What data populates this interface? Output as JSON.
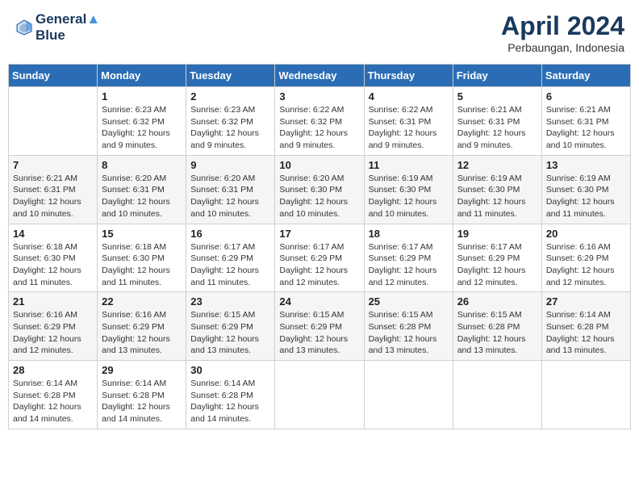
{
  "header": {
    "logo_line1": "General",
    "logo_line2": "Blue",
    "month_year": "April 2024",
    "location": "Perbaungan, Indonesia"
  },
  "weekdays": [
    "Sunday",
    "Monday",
    "Tuesday",
    "Wednesday",
    "Thursday",
    "Friday",
    "Saturday"
  ],
  "weeks": [
    [
      {
        "day": "",
        "info": ""
      },
      {
        "day": "1",
        "info": "Sunrise: 6:23 AM\nSunset: 6:32 PM\nDaylight: 12 hours\nand 9 minutes."
      },
      {
        "day": "2",
        "info": "Sunrise: 6:23 AM\nSunset: 6:32 PM\nDaylight: 12 hours\nand 9 minutes."
      },
      {
        "day": "3",
        "info": "Sunrise: 6:22 AM\nSunset: 6:32 PM\nDaylight: 12 hours\nand 9 minutes."
      },
      {
        "day": "4",
        "info": "Sunrise: 6:22 AM\nSunset: 6:31 PM\nDaylight: 12 hours\nand 9 minutes."
      },
      {
        "day": "5",
        "info": "Sunrise: 6:21 AM\nSunset: 6:31 PM\nDaylight: 12 hours\nand 9 minutes."
      },
      {
        "day": "6",
        "info": "Sunrise: 6:21 AM\nSunset: 6:31 PM\nDaylight: 12 hours\nand 10 minutes."
      }
    ],
    [
      {
        "day": "7",
        "info": "Sunrise: 6:21 AM\nSunset: 6:31 PM\nDaylight: 12 hours\nand 10 minutes."
      },
      {
        "day": "8",
        "info": "Sunrise: 6:20 AM\nSunset: 6:31 PM\nDaylight: 12 hours\nand 10 minutes."
      },
      {
        "day": "9",
        "info": "Sunrise: 6:20 AM\nSunset: 6:31 PM\nDaylight: 12 hours\nand 10 minutes."
      },
      {
        "day": "10",
        "info": "Sunrise: 6:20 AM\nSunset: 6:30 PM\nDaylight: 12 hours\nand 10 minutes."
      },
      {
        "day": "11",
        "info": "Sunrise: 6:19 AM\nSunset: 6:30 PM\nDaylight: 12 hours\nand 10 minutes."
      },
      {
        "day": "12",
        "info": "Sunrise: 6:19 AM\nSunset: 6:30 PM\nDaylight: 12 hours\nand 11 minutes."
      },
      {
        "day": "13",
        "info": "Sunrise: 6:19 AM\nSunset: 6:30 PM\nDaylight: 12 hours\nand 11 minutes."
      }
    ],
    [
      {
        "day": "14",
        "info": "Sunrise: 6:18 AM\nSunset: 6:30 PM\nDaylight: 12 hours\nand 11 minutes."
      },
      {
        "day": "15",
        "info": "Sunrise: 6:18 AM\nSunset: 6:30 PM\nDaylight: 12 hours\nand 11 minutes."
      },
      {
        "day": "16",
        "info": "Sunrise: 6:17 AM\nSunset: 6:29 PM\nDaylight: 12 hours\nand 11 minutes."
      },
      {
        "day": "17",
        "info": "Sunrise: 6:17 AM\nSunset: 6:29 PM\nDaylight: 12 hours\nand 12 minutes."
      },
      {
        "day": "18",
        "info": "Sunrise: 6:17 AM\nSunset: 6:29 PM\nDaylight: 12 hours\nand 12 minutes."
      },
      {
        "day": "19",
        "info": "Sunrise: 6:17 AM\nSunset: 6:29 PM\nDaylight: 12 hours\nand 12 minutes."
      },
      {
        "day": "20",
        "info": "Sunrise: 6:16 AM\nSunset: 6:29 PM\nDaylight: 12 hours\nand 12 minutes."
      }
    ],
    [
      {
        "day": "21",
        "info": "Sunrise: 6:16 AM\nSunset: 6:29 PM\nDaylight: 12 hours\nand 12 minutes."
      },
      {
        "day": "22",
        "info": "Sunrise: 6:16 AM\nSunset: 6:29 PM\nDaylight: 12 hours\nand 13 minutes."
      },
      {
        "day": "23",
        "info": "Sunrise: 6:15 AM\nSunset: 6:29 PM\nDaylight: 12 hours\nand 13 minutes."
      },
      {
        "day": "24",
        "info": "Sunrise: 6:15 AM\nSunset: 6:29 PM\nDaylight: 12 hours\nand 13 minutes."
      },
      {
        "day": "25",
        "info": "Sunrise: 6:15 AM\nSunset: 6:28 PM\nDaylight: 12 hours\nand 13 minutes."
      },
      {
        "day": "26",
        "info": "Sunrise: 6:15 AM\nSunset: 6:28 PM\nDaylight: 12 hours\nand 13 minutes."
      },
      {
        "day": "27",
        "info": "Sunrise: 6:14 AM\nSunset: 6:28 PM\nDaylight: 12 hours\nand 13 minutes."
      }
    ],
    [
      {
        "day": "28",
        "info": "Sunrise: 6:14 AM\nSunset: 6:28 PM\nDaylight: 12 hours\nand 14 minutes."
      },
      {
        "day": "29",
        "info": "Sunrise: 6:14 AM\nSunset: 6:28 PM\nDaylight: 12 hours\nand 14 minutes."
      },
      {
        "day": "30",
        "info": "Sunrise: 6:14 AM\nSunset: 6:28 PM\nDaylight: 12 hours\nand 14 minutes."
      },
      {
        "day": "",
        "info": ""
      },
      {
        "day": "",
        "info": ""
      },
      {
        "day": "",
        "info": ""
      },
      {
        "day": "",
        "info": ""
      }
    ]
  ]
}
